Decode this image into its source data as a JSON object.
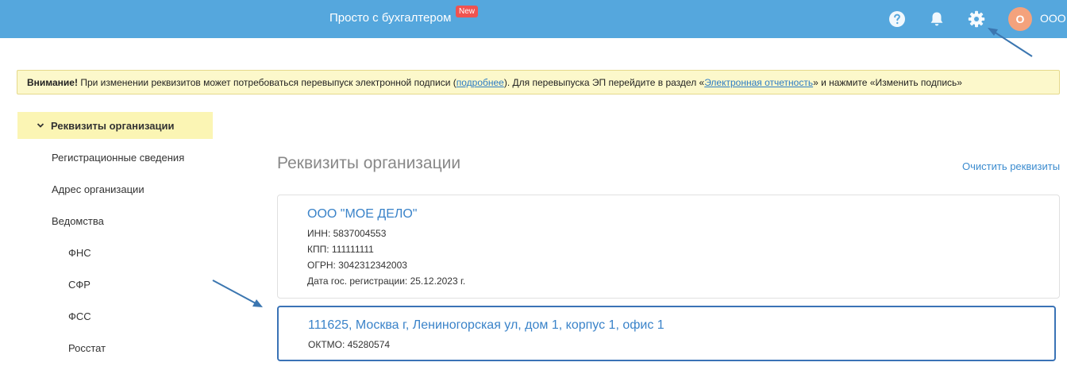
{
  "header": {
    "brand": "Просто с бухгалтером",
    "new_badge": "New",
    "avatar_letter": "О",
    "org_short": "ООО"
  },
  "warning": {
    "bold": "Внимание!",
    "text1": " При изменении реквизитов может потребоваться перевыпуск электронной подписи (",
    "link1": "подробнее",
    "text2": "). Для перевыпуска ЭП перейдите в раздел «",
    "link2": "Электронная отчетность",
    "text3": "» и нажмите «Изменить подпись»"
  },
  "sidebar": {
    "active_label": "Реквизиты организации",
    "items": [
      {
        "label": "Регистрационные сведения"
      },
      {
        "label": "Адрес организации"
      },
      {
        "label": "Ведомства"
      },
      {
        "label": "ФНС"
      },
      {
        "label": "СФР"
      },
      {
        "label": "ФСС"
      },
      {
        "label": "Росстат"
      }
    ]
  },
  "main": {
    "title": "Реквизиты организации",
    "clear_label": "Очистить реквизиты",
    "org_card": {
      "name": "ООО  \"МОЕ ДЕЛО\"",
      "inn": "ИНН: 5837004553",
      "kpp": "КПП: 111111111",
      "ogrn": "ОГРН: 3042312342003",
      "reg_date": "Дата гос. регистрации: 25.12.2023 г."
    },
    "address_card": {
      "address": "111625, Москва г, Лениногорская ул, дом 1, корпус 1, офис 1",
      "oktmo": "ОКТМО: 45280574"
    }
  },
  "icons": {
    "help": "help-icon",
    "bell": "bell-icon",
    "gear": "gear-icon",
    "chevron": "chevron-down-icon"
  },
  "colors": {
    "header_bg": "#55a7dd",
    "accent_link": "#3a83c9",
    "warning_bg": "#fcf8cb",
    "active_item_bg": "#fbf5b4",
    "highlight_border": "#3a73b6",
    "annotation_arrow": "#3b76b0"
  }
}
